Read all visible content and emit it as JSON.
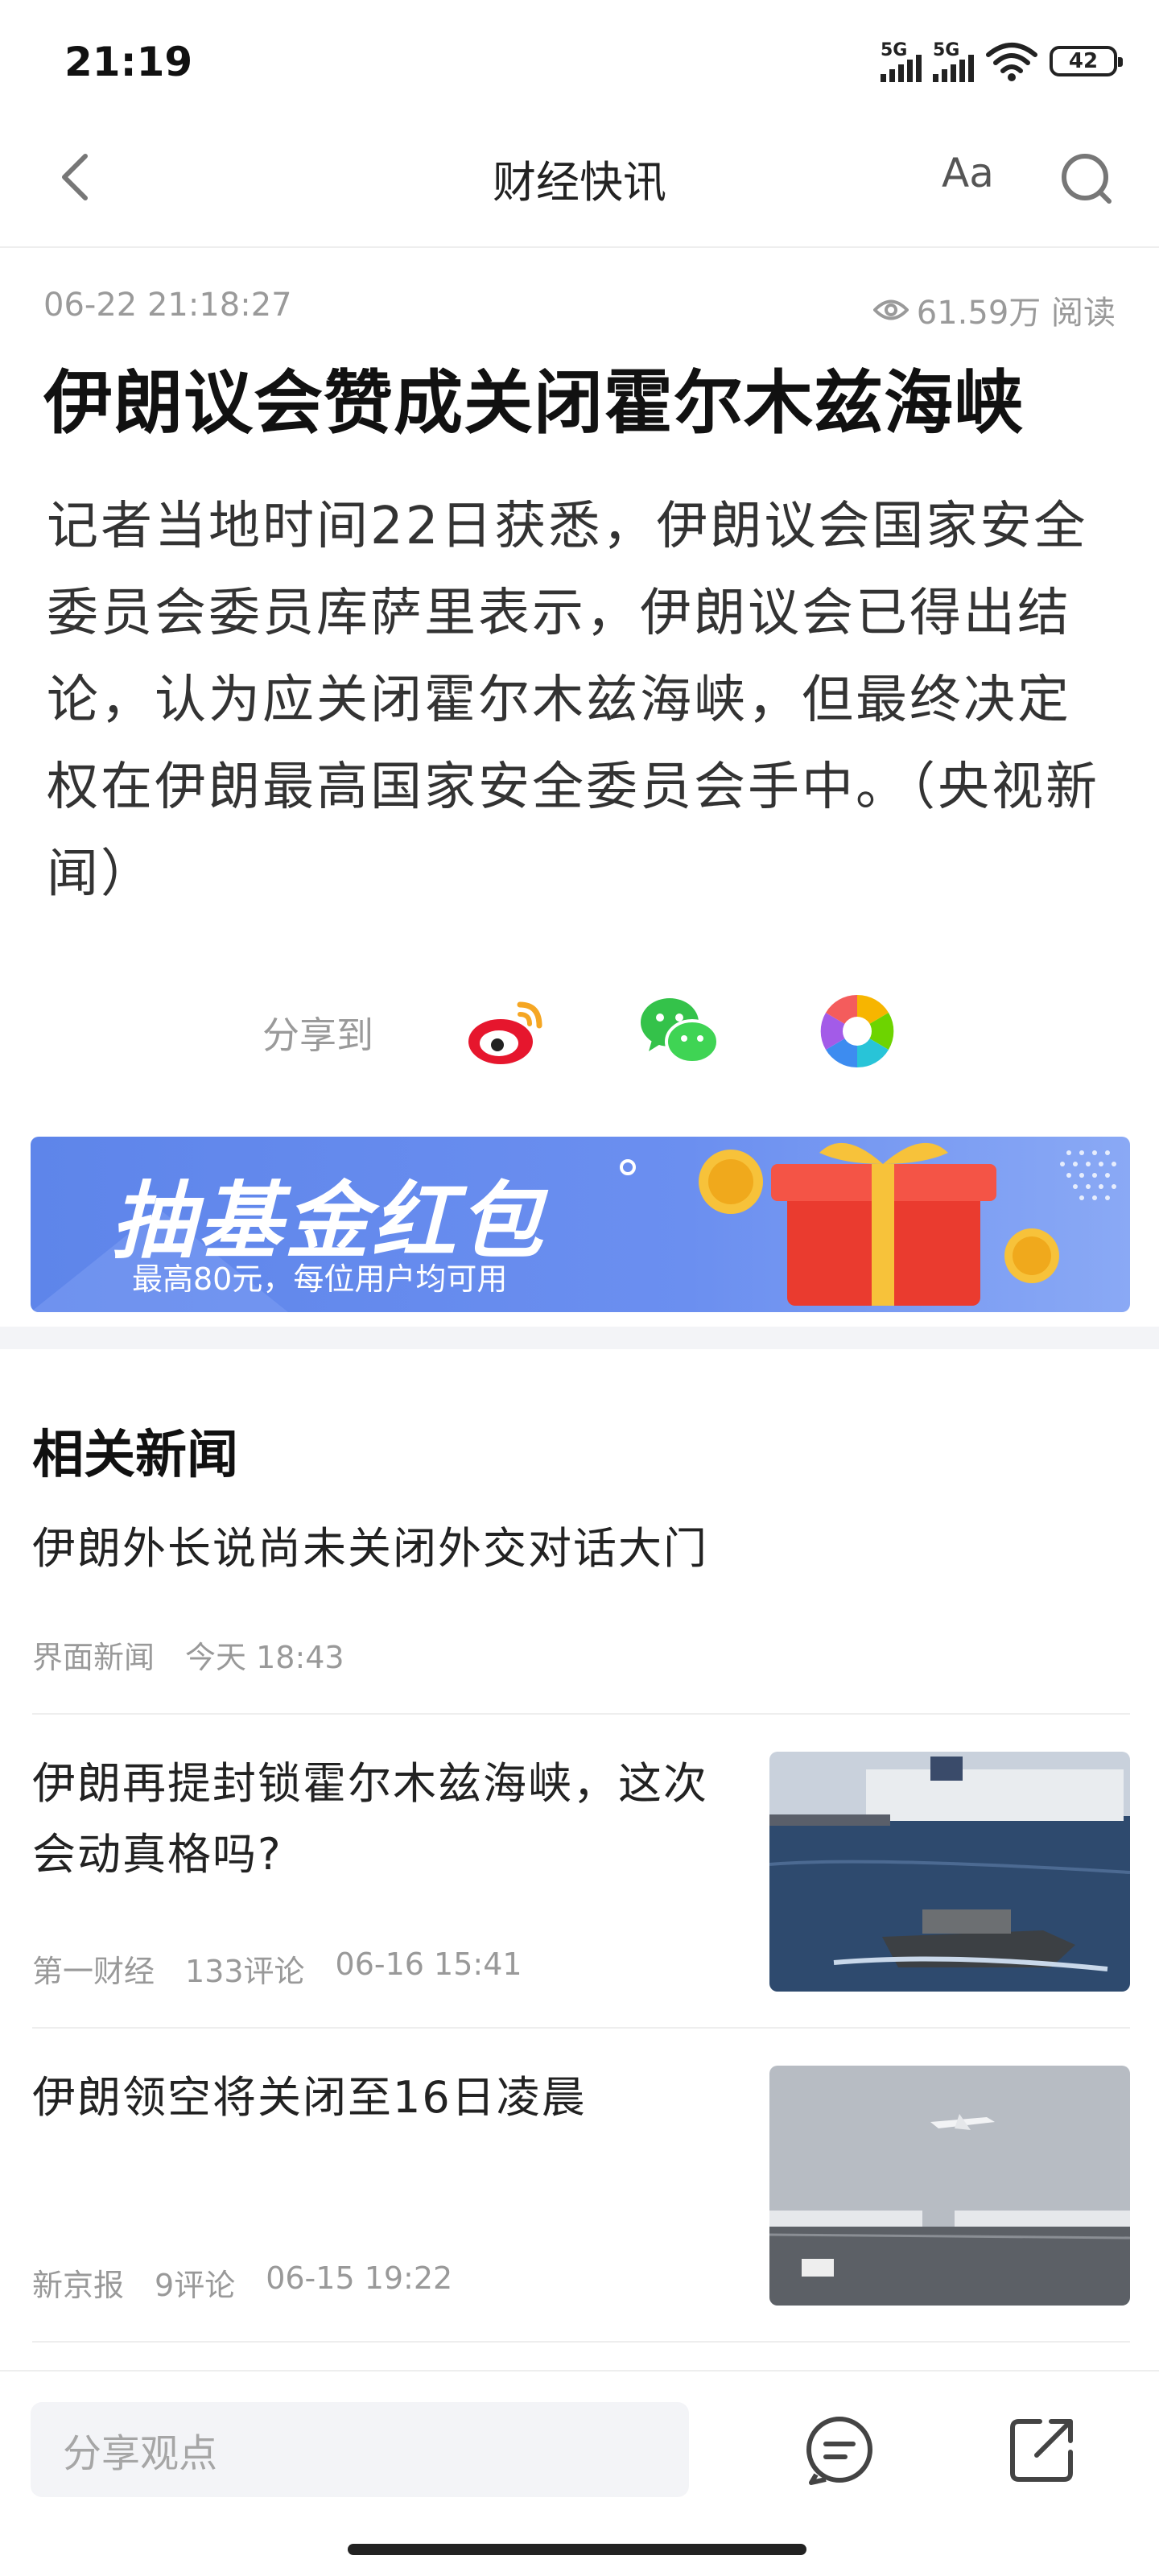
{
  "status_bar": {
    "time": "21:19",
    "signal1": "5G",
    "signal2": "5G",
    "battery": "42"
  },
  "nav": {
    "title": "财经快讯",
    "font_label": "Aa"
  },
  "article": {
    "time": "06-22 21:18:27",
    "views": "61.59万 阅读",
    "title": "伊朗议会赞成关闭霍尔木兹海峡",
    "body": "记者当地时间22日获悉，伊朗议会国家安全委员会委员库萨里表示，伊朗议会已得出结论，认为应关闭霍尔木兹海峡，但最终决定权在伊朗最高国家安全委员会手中。（央视新闻）"
  },
  "share": {
    "label": "分享到",
    "icons": [
      "weibo-icon",
      "wechat-icon",
      "moments-icon"
    ]
  },
  "banner": {
    "title": "抽基金红包",
    "subtitle": "最高80元，每位用户均可用"
  },
  "related": {
    "heading": "相关新闻",
    "items": [
      {
        "title": "伊朗外长说尚未关闭外交对话大门",
        "source": "界面新闻",
        "comments": "",
        "time": "今天 18:43"
      },
      {
        "title": "伊朗再提封锁霍尔木兹海峡，这次会动真格吗?",
        "source": "第一财经",
        "comments": "133评论",
        "time": "06-16 15:41"
      },
      {
        "title": "伊朗领空将关闭至16日凌晨",
        "source": "新京报",
        "comments": "9评论",
        "time": "06-15 19:22"
      }
    ]
  },
  "bottom_bar": {
    "placeholder": "分享观点"
  },
  "colors": {
    "accent": "#5e85ea",
    "meta": "#9a9a9a",
    "background": "#ffffff"
  }
}
